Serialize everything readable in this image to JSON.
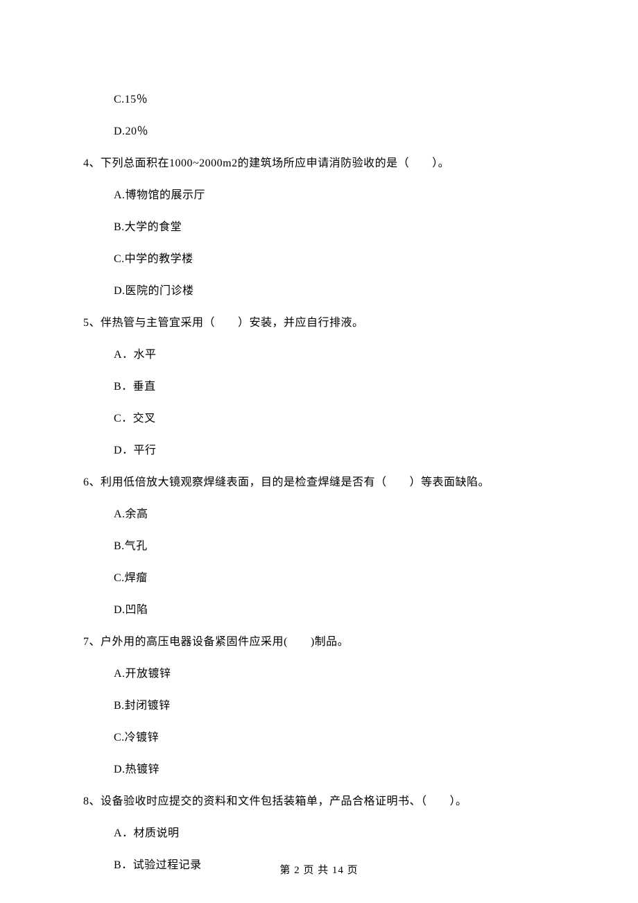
{
  "q3": {
    "options": {
      "C": "C.15％",
      "D": "D.20％"
    }
  },
  "q4": {
    "text": "4、下列总面积在1000~2000m2的建筑场所应申请消防验收的是（　　）。",
    "options": {
      "A": "A.博物馆的展示厅",
      "B": "B.大学的食堂",
      "C": "C.中学的教学楼",
      "D": "D.医院的门诊楼"
    }
  },
  "q5": {
    "text": "5、伴热管与主管宜采用（　　）安装，并应自行排液。",
    "options": {
      "A": "A．水平",
      "B": "B．垂直",
      "C": "C．交叉",
      "D": "D．平行"
    }
  },
  "q6": {
    "text": "6、利用低倍放大镜观察焊缝表面，目的是检查焊缝是否有（　　）等表面缺陷。",
    "options": {
      "A": "A.余高",
      "B": "B.气孔",
      "C": "C.焊瘤",
      "D": "D.凹陷"
    }
  },
  "q7": {
    "text": "7、户外用的高压电器设备紧固件应采用(　　)制品。",
    "options": {
      "A": "A.开放镀锌",
      "B": "B.封闭镀锌",
      "C": "C.冷镀锌",
      "D": "D.热镀锌"
    }
  },
  "q8": {
    "text": "8、设备验收时应提交的资料和文件包括装箱单，产品合格证明书、（　　）。",
    "options": {
      "A": "A．材质说明",
      "B": "B．试验过程记录"
    }
  },
  "footer": "第 2 页 共 14 页"
}
